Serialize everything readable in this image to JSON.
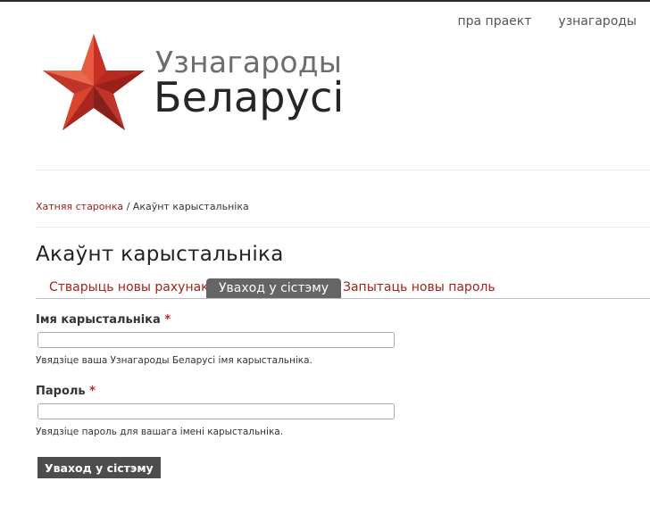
{
  "nav": {
    "about": "пра праект",
    "awards": "узнагароды"
  },
  "brand": {
    "line1": "Узнагароды",
    "line2": "Беларусі"
  },
  "breadcrumb": {
    "home": "Хатняя старонка",
    "separator": " / ",
    "current": "Акаўнт карыстальніка"
  },
  "page_title": "Акаўнт карыстальніка",
  "tabs": [
    {
      "label": "Стварыць новы рахунак",
      "active": false
    },
    {
      "label": "Уваход у сістэму",
      "active": true
    },
    {
      "label": "Запытаць новы пароль",
      "active": false
    }
  ],
  "form": {
    "username": {
      "label": "Імя карыстальніка",
      "required_mark": "*",
      "value": "",
      "description": "Увядзіце ваша Узнагароды Беларусі імя карыстальніка."
    },
    "password": {
      "label": "Пароль",
      "required_mark": "*",
      "value": "",
      "description": "Увядзіце пароль для вашага імені карыстальніка."
    },
    "submit_label": "Уваход у сістэму"
  },
  "colors": {
    "link": "#9b1b14",
    "tab_active_bg": "#656565",
    "required": "#cc1f1f",
    "button_bg": "#4d4d4d",
    "star": "#d93a2b"
  }
}
